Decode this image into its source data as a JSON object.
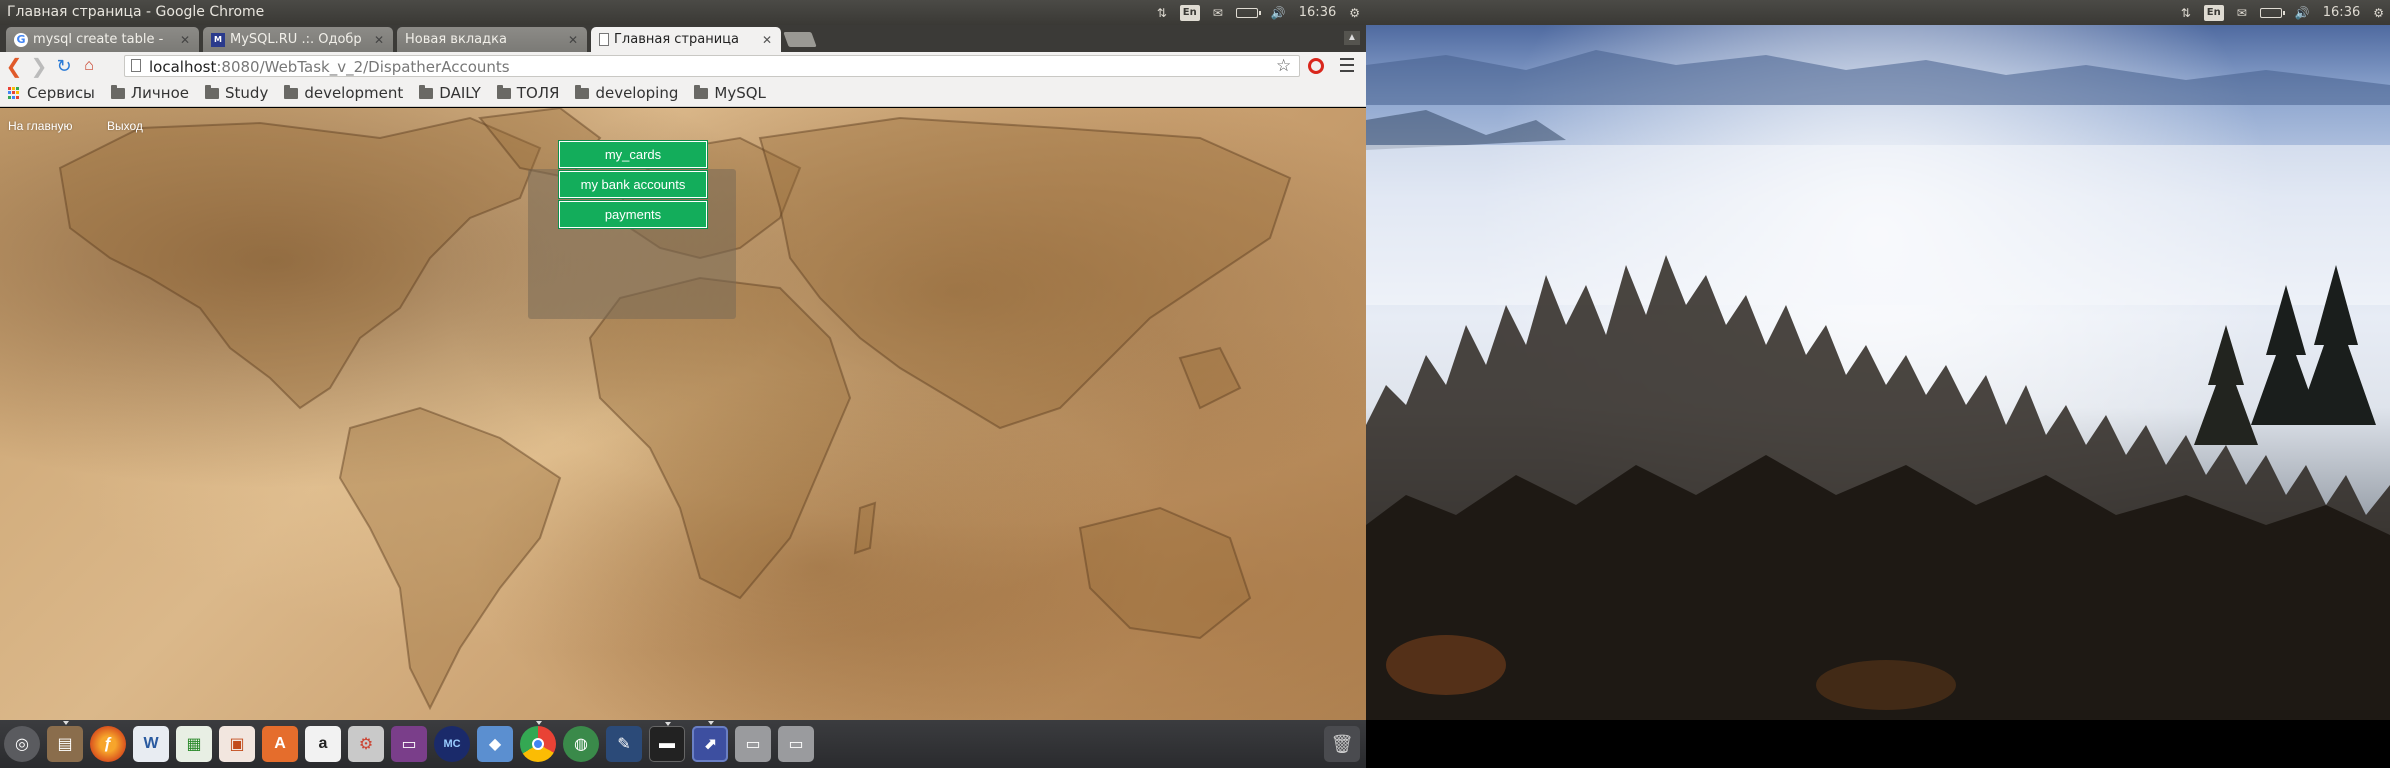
{
  "left_screen": {
    "panel": {
      "window_title": "Главная страница - Google Chrome",
      "indicators": {
        "keyboard_layout": "En",
        "time": "16:36"
      }
    },
    "browser": {
      "tabs": [
        {
          "title": "mysql create table -",
          "favicon": "google-icon",
          "active": false
        },
        {
          "title": "MySQL.RU .:. Одобр",
          "favicon": "mysql-ru-icon",
          "active": false
        },
        {
          "title": "Новая вкладка",
          "favicon": "none",
          "active": false
        },
        {
          "title": "Главная страница",
          "favicon": "page-icon",
          "active": true
        }
      ],
      "url": {
        "host": "localhost",
        "rest": ":8080/WebTask_v_2/DispatherAccounts"
      },
      "bookmarks": [
        {
          "label": "Сервисы",
          "icon": "apps-icon"
        },
        {
          "label": "Личное",
          "icon": "folder-icon"
        },
        {
          "label": "Study",
          "icon": "folder-icon"
        },
        {
          "label": "development",
          "icon": "folder-icon"
        },
        {
          "label": "DAILY",
          "icon": "folder-icon"
        },
        {
          "label": "ТОЛЯ",
          "icon": "folder-icon"
        },
        {
          "label": "developing",
          "icon": "folder-icon"
        },
        {
          "label": "MySQL",
          "icon": "folder-icon"
        }
      ]
    },
    "page": {
      "nav": {
        "home": "На главную",
        "exit": "Выход"
      },
      "menu": {
        "cards": "my_cards",
        "accounts": "my bank accounts",
        "payments": "payments"
      },
      "accent_color": "#13ad5b"
    },
    "launcher_icons": [
      "dash-icon",
      "files-icon",
      "firefox-icon",
      "writer-icon",
      "calc-icon",
      "impress-icon",
      "software-center-icon",
      "amazon-icon",
      "settings-icon",
      "app-window-icon",
      "mc-icon",
      "cube-icon",
      "chrome-icon",
      "network-icon",
      "editor-icon",
      "terminal-icon",
      "screenshot-icon",
      "drive-icon",
      "drive-icon"
    ]
  },
  "right_screen": {
    "panel": {
      "indicators": {
        "keyboard_layout": "En",
        "time": "16:36"
      }
    },
    "launcher_icons": [
      "dash-icon",
      "files-icon",
      "firefox-icon",
      "writer-icon",
      "calc-icon",
      "impress-icon",
      "software-center-icon",
      "amazon-icon",
      "settings-icon",
      "app-window-icon",
      "mc-icon",
      "cube-icon",
      "chrome-icon",
      "network-icon",
      "editor-icon",
      "terminal-icon",
      "screenshot-icon",
      "drive-icon",
      "drive-icon"
    ]
  }
}
